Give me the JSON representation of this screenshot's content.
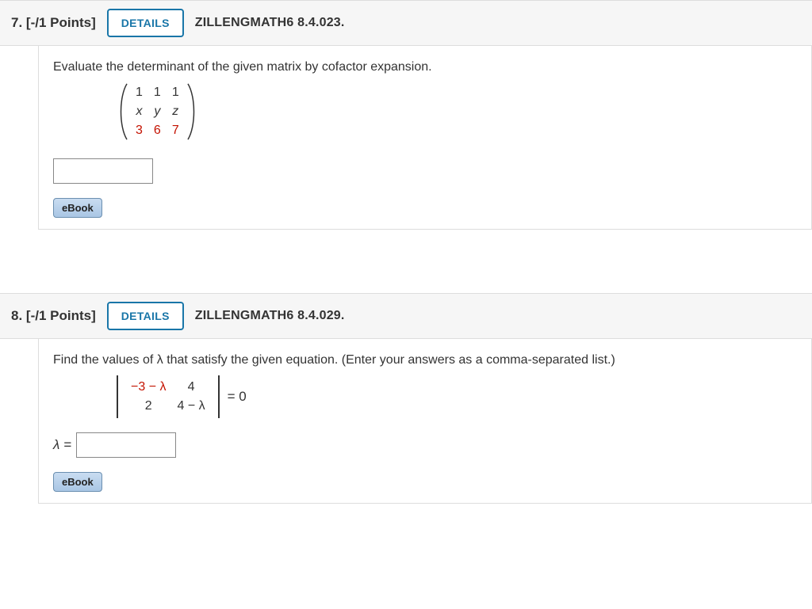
{
  "problems": [
    {
      "number": "7.",
      "points": "[-/1 Points]",
      "details_label": "DETAILS",
      "ref": "ZILLENGMATH6 8.4.023.",
      "prompt": "Evaluate the determinant of the given matrix by cofactor expansion.",
      "matrix": {
        "r0c0": "1",
        "r0c1": "1",
        "r0c2": "1",
        "r1c0": "x",
        "r1c1": "y",
        "r1c2": "z",
        "r2c0": "3",
        "r2c1": "6",
        "r2c2": "7"
      },
      "ebook_label": "eBook"
    },
    {
      "number": "8.",
      "points": "[-/1 Points]",
      "details_label": "DETAILS",
      "ref": "ZILLENGMATH6 8.4.029.",
      "prompt": "Find the values of λ that satisfy the given equation. (Enter your answers as a comma-separated list.)",
      "det": {
        "a11": "−3 − λ",
        "a12": "4",
        "a21": "2",
        "a22": "4 − λ",
        "rhs": "= 0"
      },
      "answer_label": "λ =",
      "ebook_label": "eBook"
    }
  ]
}
